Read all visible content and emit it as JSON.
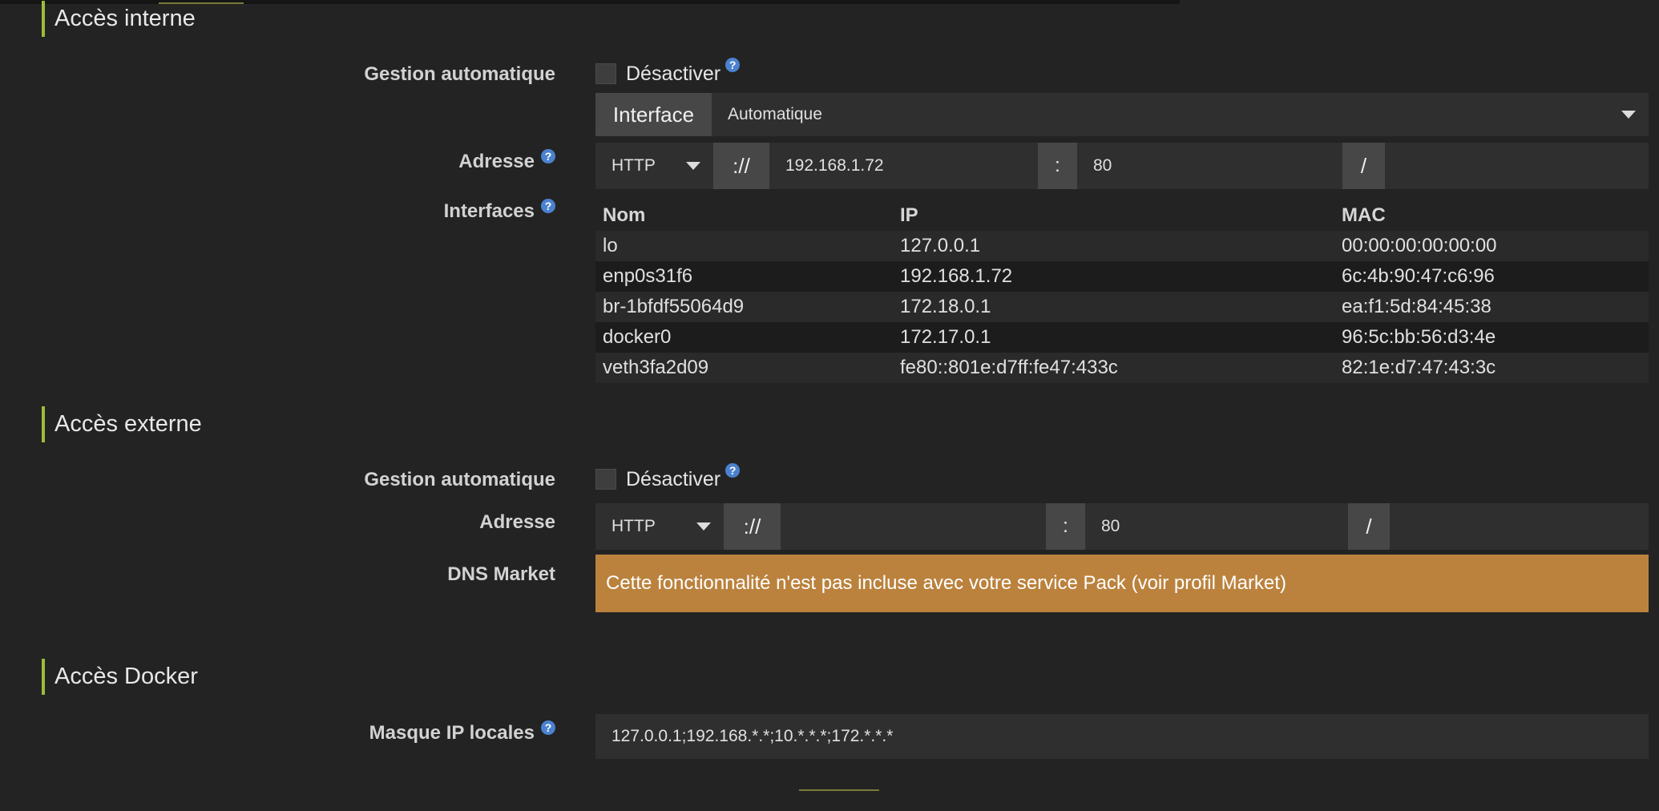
{
  "internal": {
    "title": "Accès interne",
    "auto_label": "Gestion automatique",
    "disable_label": "Désactiver",
    "interface_label": "Interface",
    "interface_value": "Automatique",
    "address_label": "Adresse",
    "protocol": "HTTP",
    "scheme_sep": "://",
    "host": "192.168.1.72",
    "port_sep": ":",
    "port": "80",
    "path_sep": "/",
    "path": "",
    "interfaces_label": "Interfaces",
    "columns": [
      "Nom",
      "IP",
      "MAC"
    ],
    "rows": [
      [
        "lo",
        "127.0.0.1",
        "00:00:00:00:00:00"
      ],
      [
        "enp0s31f6",
        "192.168.1.72",
        "6c:4b:90:47:c6:96"
      ],
      [
        "br-1bfdf55064d9",
        "172.18.0.1",
        "ea:f1:5d:84:45:38"
      ],
      [
        "docker0",
        "172.17.0.1",
        "96:5c:bb:56:d3:4e"
      ],
      [
        "veth3fa2d09",
        "fe80::801e:d7ff:fe47:433c",
        "82:1e:d7:47:43:3c"
      ]
    ]
  },
  "external": {
    "title": "Accès externe",
    "auto_label": "Gestion automatique",
    "disable_label": "Désactiver",
    "address_label": "Adresse",
    "protocol": "HTTP",
    "scheme_sep": "://",
    "host": "",
    "port_sep": ":",
    "port": "80",
    "path_sep": "/",
    "path": "",
    "dns_label": "DNS Market",
    "dns_warning": "Cette fonctionnalité n'est pas incluse avec votre service Pack (voir profil Market)"
  },
  "docker": {
    "title": "Accès Docker",
    "mask_label": "Masque IP locales",
    "mask_value": "127.0.0.1;192.168.*.*;10.*.*.*;172.*.*.*"
  },
  "help_glyph": "?",
  "colors": {
    "accent": "#9bbd3a",
    "help": "#4b82cf",
    "warning": "#bb823d",
    "background": "#232323"
  }
}
